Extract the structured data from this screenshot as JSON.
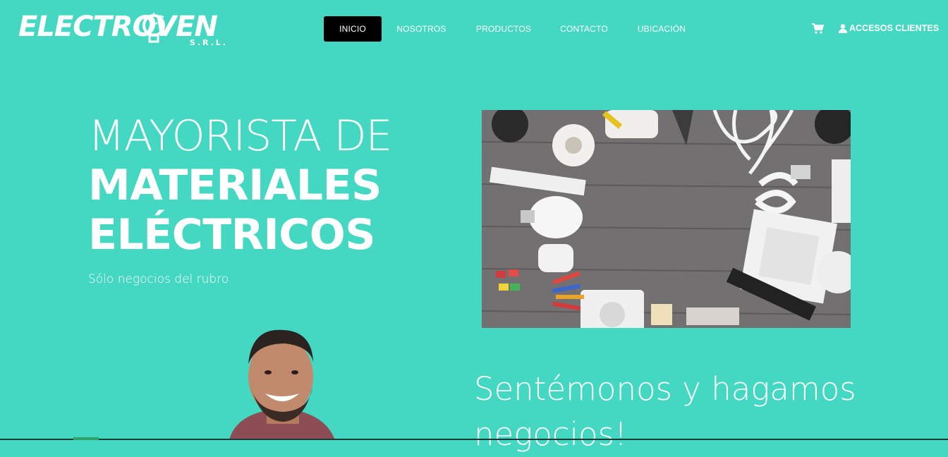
{
  "brand": {
    "name": "ELECTROVEN",
    "suffix": "S.R.L."
  },
  "nav": [
    {
      "label": "INICIO",
      "active": true
    },
    {
      "label": "NOSOTROS",
      "active": false
    },
    {
      "label": "PRODUCTOS",
      "active": false
    },
    {
      "label": "CONTACTO",
      "active": false
    },
    {
      "label": "UBICACIÓN",
      "active": false
    }
  ],
  "header_actions": {
    "cart_icon": "shopping-cart-icon",
    "clients_label": "ACCESOS CLIENTES",
    "clients_icon": "user-icon"
  },
  "hero": {
    "line1": "MAYORISTA DE",
    "line2": "MATERIALES",
    "line3": "ELÉCTRICOS",
    "subtitle": "Sólo negocios del rubro"
  },
  "tagline": {
    "line1": "Sentémonos y hagamos",
    "line2": "negocios!"
  },
  "colors": {
    "background": "#44d7c2",
    "nav_active": "#000000",
    "text": "#ffffff"
  }
}
